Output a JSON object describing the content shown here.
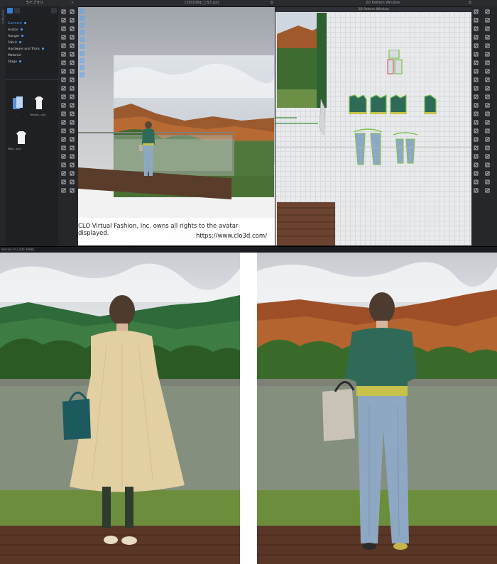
{
  "window": {
    "tab_label": "ライブラリ",
    "file_title": "CD0108(J)_CS3.zprj",
    "pattern_title": "2D Pattern Window"
  },
  "library": {
    "side_tab": "ライブラリ",
    "tree": [
      "Garment",
      "Avatar",
      "Hanger",
      "Fabric",
      "Hardware and Trims",
      "Material",
      "Stage"
    ],
    "files": [
      "..",
      "Female...zprj",
      "Male...zprj"
    ]
  },
  "viewport_3d": {
    "credit_line_1": "CLO Virtual Fashion, Inc. owns all rights to the avatar displayed.",
    "credit_line_2": "https://www.clo3d.com/"
  },
  "status": {
    "version": "Version: 6.2.430.39881"
  },
  "colors": {
    "app_bg": "#1e1f22",
    "accent": "#4aa3ff",
    "pattern_green": "#7cc24a",
    "sweater_green": "#2f6a58",
    "denim": "#8ea8c4",
    "dress_beige": "#e2cfa2"
  },
  "icons": {
    "tools_left": [
      "select-icon",
      "move-icon",
      "pen-icon",
      "box-icon",
      "sphere-icon",
      "arrow-icon",
      "brush-icon",
      "pin-icon",
      "fold-icon",
      "sew-icon",
      "zoom-icon",
      "measure-icon"
    ],
    "tools_right": [
      "grid-icon",
      "arrange-icon",
      "segment-icon",
      "curve-icon",
      "point-icon",
      "text-icon",
      "notch-icon",
      "dart-icon",
      "pleat-icon",
      "trace-icon"
    ]
  }
}
